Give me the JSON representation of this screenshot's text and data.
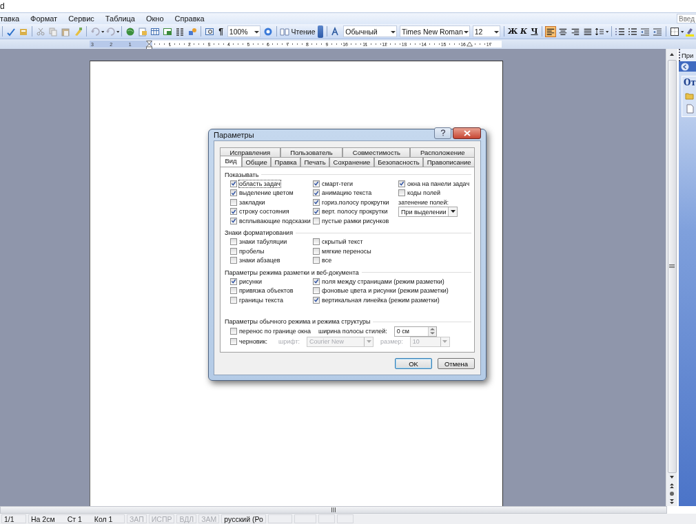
{
  "app": {
    "title": "d"
  },
  "menu": [
    {
      "label": "тавка"
    },
    {
      "label": "Формат"
    },
    {
      "label": "Сервис"
    },
    {
      "label": "Таблица"
    },
    {
      "label": "Окно"
    },
    {
      "label": "Справка"
    }
  ],
  "ask_field": {
    "placeholder": "Введ"
  },
  "toolbar": {
    "pilcrow": "¶",
    "zoom": "100%",
    "reading": "Чтение",
    "style": "Обычный",
    "font": "Times New Roman",
    "size": "12",
    "format_buttons": [
      {
        "kind": "bold",
        "label": "Ж"
      },
      {
        "kind": "italic",
        "label": "К"
      },
      {
        "kind": "underline",
        "label": "Ч"
      }
    ],
    "align_buttons": [
      {
        "selected": true
      },
      {
        "selected": false
      },
      {
        "selected": false
      },
      {
        "selected": false
      }
    ]
  },
  "ruler": {
    "left_labels": [
      "3",
      "2",
      "1"
    ],
    "labels": [
      "1",
      "2",
      "3",
      "4",
      "5",
      "6",
      "7",
      "8",
      "9",
      "10",
      "11",
      "12",
      "13",
      "14",
      "15",
      "16",
      "17"
    ]
  },
  "task_pane": {
    "title": "При",
    "heading": "От"
  },
  "dialog": {
    "title": "Параметры",
    "tab_rows": [
      [
        {
          "label": "Исправления",
          "selected": false
        },
        {
          "label": "Пользователь",
          "selected": false
        },
        {
          "label": "Совместимость",
          "selected": false
        },
        {
          "label": "Расположение",
          "selected": false
        }
      ],
      [
        {
          "label": "Вид",
          "selected": true
        },
        {
          "label": "Общие",
          "selected": false
        },
        {
          "label": "Правка",
          "selected": false
        },
        {
          "label": "Печать",
          "selected": false
        },
        {
          "label": "Сохранение",
          "selected": false
        },
        {
          "label": "Безопасность",
          "selected": false
        },
        {
          "label": "Правописание",
          "selected": false
        }
      ]
    ],
    "sections": [
      {
        "title": "Показывать",
        "columns": [
          [
            {
              "kind": "checkbox",
              "label": "область задач",
              "checked": true,
              "focused": true
            },
            {
              "kind": "checkbox",
              "label": "выделение цветом",
              "checked": true
            },
            {
              "kind": "checkbox",
              "label": "закладки",
              "checked": false
            },
            {
              "kind": "checkbox",
              "label": "строку состояния",
              "checked": true
            },
            {
              "kind": "checkbox",
              "label": "всплывающие подсказки",
              "checked": true
            }
          ],
          [
            {
              "kind": "checkbox",
              "label": "смарт-теги",
              "checked": true
            },
            {
              "kind": "checkbox",
              "label": "анимацию текста",
              "checked": true
            },
            {
              "kind": "checkbox",
              "label": "гориз.полосу прокрутки",
              "checked": true
            },
            {
              "kind": "checkbox",
              "label": "верт. полосу прокрутки",
              "checked": true
            },
            {
              "kind": "checkbox",
              "label": "пустые рамки рисунков",
              "checked": false
            }
          ],
          [
            {
              "kind": "checkbox",
              "label": "окна на панели задач",
              "checked": true
            },
            {
              "kind": "checkbox",
              "label": "коды полей",
              "checked": false
            },
            {
              "kind": "label",
              "text": "затенение полей:"
            },
            {
              "kind": "select",
              "value": "При выделении"
            }
          ]
        ]
      },
      {
        "title": "Знаки форматирования",
        "columns": [
          [
            {
              "kind": "checkbox",
              "label": "знаки табуляции",
              "checked": false
            },
            {
              "kind": "checkbox",
              "label": "пробелы",
              "checked": false
            },
            {
              "kind": "checkbox",
              "label": "знаки абзацев",
              "checked": false
            }
          ],
          [
            {
              "kind": "checkbox",
              "label": "скрытый текст",
              "checked": false
            },
            {
              "kind": "checkbox",
              "label": "мягкие переносы",
              "checked": false
            },
            {
              "kind": "checkbox",
              "label": "все",
              "checked": false
            }
          ]
        ]
      },
      {
        "title": "Параметры режима разметки и веб-документа",
        "columns": [
          [
            {
              "kind": "checkbox",
              "label": "рисунки",
              "checked": true
            },
            {
              "kind": "checkbox",
              "label": "привязка объектов",
              "checked": false
            },
            {
              "kind": "checkbox",
              "label": "границы текста",
              "checked": false
            }
          ],
          [
            {
              "kind": "checkbox",
              "label": "поля между страницами (режим разметки)",
              "checked": true
            },
            {
              "kind": "checkbox",
              "label": "фоновые цвета и рисунки (режим разметки)",
              "checked": false
            },
            {
              "kind": "checkbox",
              "label": "вертикальная линейка (режим разметки)",
              "checked": true
            }
          ]
        ]
      },
      {
        "title": "Параметры обычного режима и режима структуры",
        "lines": [
          {
            "controls": [
              {
                "kind": "checkbox",
                "label": "перенос по границе окна",
                "checked": false
              },
              {
                "kind": "label",
                "text": "ширина полосы стилей:"
              },
              {
                "kind": "spin",
                "value": "0 см"
              }
            ]
          },
          {
            "controls": [
              {
                "kind": "checkbox",
                "label": "черновик:",
                "checked": false
              },
              {
                "kind": "label",
                "text": "шрифт:",
                "disabled": true
              },
              {
                "kind": "select",
                "value": "Courier New",
                "disabled": true
              },
              {
                "kind": "label",
                "text": "размер:",
                "disabled": true
              },
              {
                "kind": "select",
                "value": "10",
                "disabled": true
              }
            ]
          }
        ]
      }
    ],
    "buttons": [
      {
        "label": "OK",
        "default": true
      },
      {
        "label": "Отмена",
        "default": false
      }
    ]
  },
  "status_bar": [
    {
      "text": "1/1"
    },
    {
      "text": "На 2см"
    },
    {
      "text": "Ст 1"
    },
    {
      "text": "Кол 1"
    },
    {
      "text": "ЗАП",
      "disabled": true
    },
    {
      "text": "ИСПР",
      "disabled": true
    },
    {
      "text": "ВДЛ",
      "disabled": true
    },
    {
      "text": "ЗАМ",
      "disabled": true
    },
    {
      "text": "русский (Ро"
    }
  ]
}
